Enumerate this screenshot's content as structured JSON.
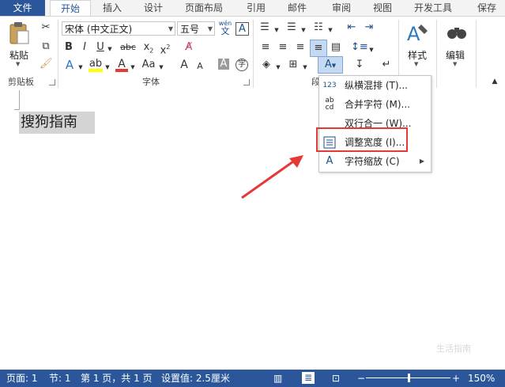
{
  "tabs": {
    "file": "文件",
    "items": [
      "开始",
      "插入",
      "设计",
      "页面布局",
      "引用",
      "邮件",
      "审阅",
      "视图",
      "开发工具",
      "保存"
    ]
  },
  "clipboard": {
    "paste_label": "粘贴",
    "group_label": "剪贴板"
  },
  "font": {
    "family": "宋体 (中文正文)",
    "size": "五号",
    "group_label": "字体",
    "wen_label": "wén",
    "a_label": "A",
    "grow_label": "A",
    "shrink_label": "A",
    "case_label": "Aa"
  },
  "paragraph": {
    "group_label": "段"
  },
  "styles": {
    "label": "样式"
  },
  "editing": {
    "label": "编辑"
  },
  "document": {
    "text": "搜狗指南"
  },
  "menu": {
    "items": [
      {
        "icon": "123",
        "label": "纵横混排 (T)..."
      },
      {
        "icon": "abcd",
        "label": "合并字符 (M)..."
      },
      {
        "icon": "",
        "label": "双行合一 (W)..."
      },
      {
        "icon": "adjust-width-icon",
        "label": "调整宽度 (I)..."
      },
      {
        "icon": "char-scale-icon",
        "label": "字符缩放 (C)",
        "submenu": true
      }
    ]
  },
  "status": {
    "page": "页面: 1",
    "section": "节: 1",
    "pages": "第 1 页，共 1 页",
    "setting": "设置值: 2.5厘米",
    "zoom_minus": "−",
    "zoom_plus": "+",
    "zoom_level": "150%"
  },
  "watermark": "生活指南",
  "colors": {
    "accent": "#2b579a",
    "highlight_red": "#e53935",
    "arrow_red": "#e53935"
  }
}
